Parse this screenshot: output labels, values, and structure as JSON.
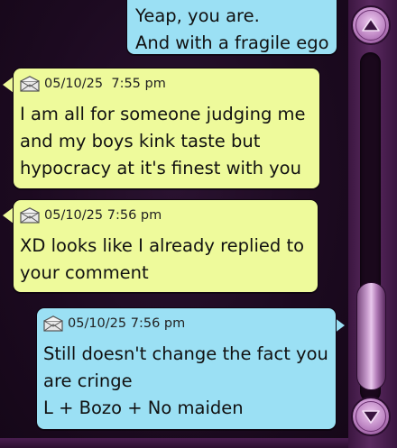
{
  "messages": [
    {
      "side": "right",
      "color": "blue",
      "has_header": false,
      "text": "Yeap, you are.\nAnd with a fragile ego"
    },
    {
      "side": "left",
      "color": "yellow",
      "has_header": true,
      "timestamp": "05/10/25  7:55 pm",
      "text": "I am all for someone judging me\nand my boys kink taste but\nhypocracy at it's finest with you"
    },
    {
      "side": "left",
      "color": "yellow",
      "has_header": true,
      "timestamp": "05/10/25 7:56 pm",
      "text": "XD looks like I already replied to\nyour comment"
    },
    {
      "side": "right",
      "color": "blue",
      "has_header": true,
      "timestamp": "05/10/25 7:56 pm",
      "text": "Still doesn't change the fact you\nare cringe\nL + Bozo + No maiden"
    }
  ],
  "icons": {
    "message_icon": "envelope-icon",
    "scroll_up": "triangle-up-icon",
    "scroll_down": "triangle-down-icon"
  },
  "colors": {
    "incoming_bubble": "#eefa9b",
    "outgoing_bubble": "#9be0f4",
    "background": "#1c0a20",
    "scrollbar": "#5a2a60"
  }
}
